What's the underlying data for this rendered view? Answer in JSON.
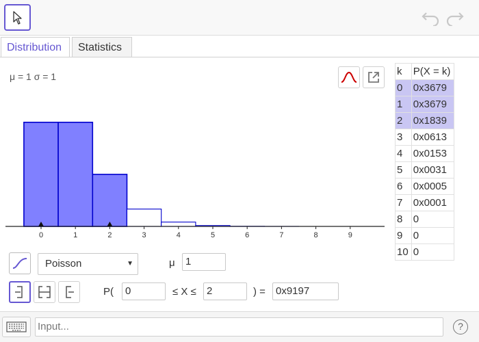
{
  "toolbar": {
    "move_tool_icon": "arrow-pointer-icon",
    "undo_icon": "undo-icon",
    "redo_icon": "redo-icon"
  },
  "tabs": [
    {
      "label": "Distribution",
      "active": true
    },
    {
      "label": "Statistics",
      "active": false
    }
  ],
  "params_text": "μ = 1 σ = 1",
  "chart_data": {
    "type": "bar",
    "categories": [
      "0",
      "1",
      "2",
      "3",
      "4",
      "5",
      "6",
      "7",
      "8",
      "9"
    ],
    "values": [
      0.3679,
      0.3679,
      0.1839,
      0.0613,
      0.0153,
      0.0031,
      0.0005,
      0.0001,
      0,
      0
    ],
    "highlighted": [
      0,
      1,
      2
    ],
    "markers": [
      0,
      2
    ],
    "ylim": [
      0,
      0.4
    ],
    "xlim": [
      -1,
      9.5
    ],
    "highlight_color": "#8080ff",
    "outline_color": "#0000cc"
  },
  "table": {
    "headers": [
      "k",
      "P(X = k)"
    ],
    "rows": [
      {
        "k": "0",
        "p": "0x3679",
        "hl": true
      },
      {
        "k": "1",
        "p": "0x3679",
        "hl": true
      },
      {
        "k": "2",
        "p": "0x1839",
        "hl": true
      },
      {
        "k": "3",
        "p": "0x0613",
        "hl": false
      },
      {
        "k": "4",
        "p": "0x0153",
        "hl": false
      },
      {
        "k": "5",
        "p": "0x0031",
        "hl": false
      },
      {
        "k": "6",
        "p": "0x0005",
        "hl": false
      },
      {
        "k": "7",
        "p": "0x0001",
        "hl": false
      },
      {
        "k": "8",
        "p": "0",
        "hl": false
      },
      {
        "k": "9",
        "p": "0",
        "hl": false
      },
      {
        "k": "10",
        "p": "0",
        "hl": false
      }
    ]
  },
  "controls": {
    "distribution": "Poisson",
    "mu_label": "μ",
    "mu_value": "1",
    "p_open": "P(",
    "lower": "0",
    "le_x_le": "≤ X ≤",
    "upper": "2",
    "equals": ") =",
    "result": "0x9197"
  },
  "input_bar": {
    "placeholder": "Input...",
    "help": "?"
  },
  "colors": {
    "accent": "#6557d2",
    "normal_curve": "#cc0000"
  }
}
